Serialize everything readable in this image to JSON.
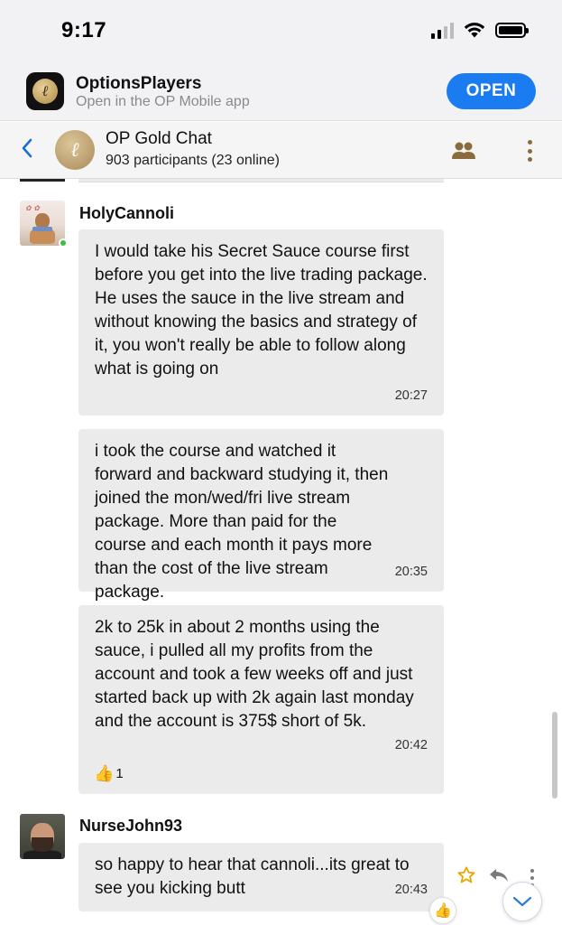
{
  "status_bar": {
    "time": "9:17"
  },
  "app_banner": {
    "app_name": "OptionsPlayers",
    "subtitle": "Open in the OP Mobile app",
    "open_label": "OPEN",
    "accent_color": "#1a7cf0"
  },
  "chat_header": {
    "title": "OP Gold Chat",
    "subtitle": "903 participants (23 online)",
    "back_icon": "chevron-left-icon",
    "participants_icon": "people-icon",
    "more_icon": "vertical-dots-icon"
  },
  "messages": [
    {
      "author": "HolyCannoli",
      "online": true,
      "bubbles": [
        {
          "text": "I would take his Secret Sauce course first before you get into the live trading package. He uses the sauce in the live stream and without knowing the basics and strategy of it, you won't really be able to follow along what is going on",
          "time": "20:27"
        },
        {
          "text": "i took the course and watched it forward and backward studying it, then joined the mon/wed/fri live stream package. More than paid for the course and each month it pays more than the cost of the live stream package.",
          "time": "20:35"
        },
        {
          "text": "2k to 25k in about 2 months using the sauce, i pulled all my profits from the account and took a few weeks off and just started back up with 2k again last monday and the account is 375$ short of 5k.",
          "time": "20:42",
          "reaction": {
            "emoji": "👍",
            "count": "1"
          }
        }
      ]
    },
    {
      "author": "NurseJohn93",
      "online": false,
      "bubbles": [
        {
          "text": "so happy to hear that cannoli...its great to see you kicking butt",
          "time": "20:43"
        }
      ]
    }
  ],
  "actions": {
    "star_icon": "star-icon",
    "reply_icon": "reply-icon",
    "more_icon": "vertical-dots-icon",
    "reaction_emoji": "👍",
    "scroll_down_icon": "chevron-down-icon"
  }
}
